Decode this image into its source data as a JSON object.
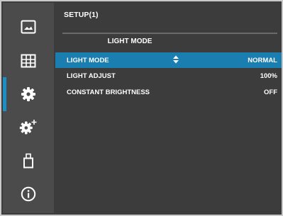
{
  "menu": {
    "title": "SETUP(1)",
    "section_header": "LIGHT MODE",
    "items": [
      {
        "label": "LIGHT MODE",
        "value": "NORMAL",
        "selected": true
      },
      {
        "label": "LIGHT ADJUST",
        "value": "100%",
        "selected": false
      },
      {
        "label": "CONSTANT BRIGHTNESS",
        "value": "OFF",
        "selected": false
      }
    ]
  },
  "sidebar": {
    "items": [
      {
        "icon": "picture-icon"
      },
      {
        "icon": "grid-icon"
      },
      {
        "icon": "gear-icon",
        "active": true
      },
      {
        "icon": "gear-plus-icon"
      },
      {
        "icon": "usb-icon"
      },
      {
        "icon": "info-icon"
      }
    ]
  },
  "colors": {
    "panel_bg": "#3c3c3c",
    "sidebar_bg": "#4b4b4b",
    "accent": "#1a7fb0",
    "text": "#ffffff"
  }
}
